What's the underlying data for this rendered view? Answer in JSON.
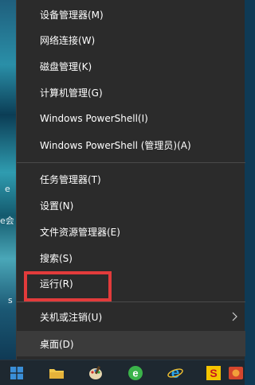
{
  "desktop": {
    "left_glyphs": [
      "e",
      "e会",
      "s"
    ]
  },
  "context_menu": {
    "groups": [
      {
        "items": [
          {
            "label": "设备管理器(M)"
          },
          {
            "label": "网络连接(W)"
          },
          {
            "label": "磁盘管理(K)"
          },
          {
            "label": "计算机管理(G)"
          },
          {
            "label": "Windows PowerShell(I)"
          },
          {
            "label": "Windows PowerShell (管理员)(A)"
          }
        ]
      },
      {
        "items": [
          {
            "label": "任务管理器(T)"
          },
          {
            "label": "设置(N)"
          },
          {
            "label": "文件资源管理器(E)"
          },
          {
            "label": "搜索(S)"
          },
          {
            "label": "运行(R)",
            "highlighted": true
          }
        ]
      },
      {
        "items": [
          {
            "label": "关机或注销(U)",
            "has_submenu": true
          },
          {
            "label": "桌面(D)",
            "hovered": true
          }
        ]
      }
    ],
    "highlight_color": "#e23b3b"
  },
  "taskbar": {
    "icons": [
      {
        "name": "windows-start-icon"
      },
      {
        "name": "file-explorer-icon"
      },
      {
        "name": "paint-icon"
      },
      {
        "name": "browser-green-e-icon"
      },
      {
        "name": "internet-explorer-icon"
      },
      {
        "name": "app-s-icon"
      },
      {
        "name": "game-icon"
      }
    ]
  }
}
